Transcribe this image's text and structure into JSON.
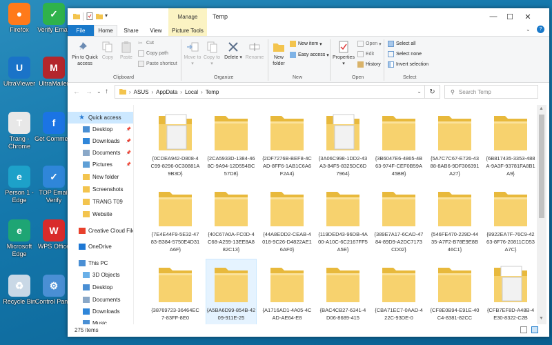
{
  "desktop": {
    "icons": [
      {
        "label": "Firefox",
        "color": "#ff7a1a",
        "glyph": "●"
      },
      {
        "label": "Verify Email",
        "color": "#2fb24b",
        "glyph": "✓"
      },
      {
        "label": "UltraViewer",
        "color": "#1a73c8",
        "glyph": "U"
      },
      {
        "label": "UltraMailer",
        "color": "#b3262c",
        "glyph": "M"
      },
      {
        "label": "Trang - Chrome",
        "color": "#e8e8e8",
        "glyph": "T"
      },
      {
        "label": "Get Comme...",
        "color": "#1b74e4",
        "glyph": "f"
      },
      {
        "label": "Person 1 - Edge",
        "color": "#1da1c9",
        "glyph": "e"
      },
      {
        "label": "TOP Email Verify",
        "color": "#2f86d9",
        "glyph": "✓"
      },
      {
        "label": "Microsoft Edge",
        "color": "#1ea574",
        "glyph": "e"
      },
      {
        "label": "WPS Office",
        "color": "#d92b2b",
        "glyph": "W"
      },
      {
        "label": "Recycle Bin",
        "color": "#c9d8e6",
        "glyph": "♻"
      },
      {
        "label": "Control Panel",
        "color": "#4a8fd4",
        "glyph": "⚙"
      }
    ]
  },
  "window": {
    "manage_tab": "Manage",
    "title": "Temp",
    "controls": {
      "minimize": "—",
      "maximize": "☐",
      "close": "✕"
    },
    "tabs": [
      "File",
      "Home",
      "Share",
      "View",
      "Picture Tools"
    ],
    "help": "?"
  },
  "ribbon": {
    "clipboard": {
      "pin": "Pin to Quick access",
      "copy": "Copy",
      "paste": "Paste",
      "cut": "Cut",
      "copy_path": "Copy path",
      "paste_shortcut": "Paste shortcut",
      "group": "Clipboard"
    },
    "organize": {
      "move_to": "Move to",
      "copy_to": "Copy to",
      "delete": "Delete",
      "rename": "Rename",
      "group": "Organize"
    },
    "new": {
      "new_folder": "New folder",
      "new_item": "New item",
      "easy_access": "Easy access",
      "group": "New"
    },
    "open": {
      "properties": "Properties",
      "open": "Open",
      "edit": "Edit",
      "history": "History",
      "group": "Open"
    },
    "select": {
      "select_all": "Select all",
      "select_none": "Select none",
      "invert_selection": "Invert selection",
      "group": "Select"
    }
  },
  "address": {
    "path": [
      "ASUS",
      "AppData",
      "Local",
      "Temp"
    ],
    "search_placeholder": "Search Temp"
  },
  "nav": {
    "items": [
      {
        "label": "Quick access",
        "icon": "star",
        "pinned": false,
        "indent": 0
      },
      {
        "label": "Desktop",
        "icon": "desktop",
        "pinned": true,
        "indent": 1
      },
      {
        "label": "Downloads",
        "icon": "download",
        "pinned": true,
        "indent": 1
      },
      {
        "label": "Documents",
        "icon": "document",
        "pinned": true,
        "indent": 1
      },
      {
        "label": "Pictures",
        "icon": "picture",
        "pinned": true,
        "indent": 1
      },
      {
        "label": "New folder",
        "icon": "folder",
        "pinned": false,
        "indent": 1
      },
      {
        "label": "Screenshots",
        "icon": "folder",
        "pinned": false,
        "indent": 1
      },
      {
        "label": "TRANG T09",
        "icon": "folder",
        "pinned": false,
        "indent": 1
      },
      {
        "label": "Website",
        "icon": "folder",
        "pinned": false,
        "indent": 1
      },
      {
        "label": "Creative Cloud File",
        "icon": "cloud-cc",
        "pinned": false,
        "indent": 0
      },
      {
        "label": "OneDrive",
        "icon": "onedrive",
        "pinned": false,
        "indent": 0
      },
      {
        "label": "This PC",
        "icon": "pc",
        "pinned": false,
        "indent": 0
      },
      {
        "label": "3D Objects",
        "icon": "cube",
        "pinned": false,
        "indent": 1
      },
      {
        "label": "Desktop",
        "icon": "desktop",
        "pinned": false,
        "indent": 1
      },
      {
        "label": "Documents",
        "icon": "document",
        "pinned": false,
        "indent": 1
      },
      {
        "label": "Downloads",
        "icon": "download",
        "pinned": false,
        "indent": 1
      },
      {
        "label": "Music",
        "icon": "music",
        "pinned": false,
        "indent": 1
      }
    ]
  },
  "files": [
    {
      "name": "{0CDEA942-D808-4C99-8296-0C30881A9B3D}",
      "type": "file"
    },
    {
      "name": "{2CA5933D-1384-468C-9A94-12D554BC57D8}",
      "type": "folder"
    },
    {
      "name": "{2DF7276B-BEF8-4CAD-8FF6-1AB1C6A6F2A4}",
      "type": "folder"
    },
    {
      "name": "{3A06C998-1DD2-43A3-84F5-8325DC6D7964}",
      "type": "file"
    },
    {
      "name": "{3B6047E6-4865-4B63-974F-CEF0B59A45BB}",
      "type": "folder"
    },
    {
      "name": "{5A7C7C67-E726-4388-8AB6-9DF306391A27}",
      "type": "folder"
    },
    {
      "name": "{6B817435-3353-488A-9A3F-93781FA8B1A9}",
      "type": "folder"
    },
    {
      "name": "{7E4E44F9-5E32-4783-B384-5750E4D31A6F}",
      "type": "folder"
    },
    {
      "name": "{40C67A0A-FC0D-4C68-A259-13EE8A882C13}",
      "type": "folder"
    },
    {
      "name": "{44A8EDD2-CEAB-4018-9C26-D4822AE16AF0}",
      "type": "folder"
    },
    {
      "name": "{119DED43-96DB-4A00-A10C-6C2167FF5A5E}",
      "type": "folder"
    },
    {
      "name": "{389E7A17-6CAD-4784-89D9-A2DC7173CD02}",
      "type": "folder"
    },
    {
      "name": "{546FE470-229D-4435-A7F2-B78E9E8B46C1}",
      "type": "folder"
    },
    {
      "name": "{8922EA7F-76C9-4263-8F76-20811CD53A7C}",
      "type": "folder"
    },
    {
      "name": "{38769723-36464EC7-83FF-8E0",
      "type": "folder"
    },
    {
      "name": "{A5BA6D99-854B-4209-911E-25",
      "type": "folder"
    },
    {
      "name": "{A1716AD1-4A05-4CAD-AE64-E8",
      "type": "folder"
    },
    {
      "name": "{BAC4CB27-6341-4D06-8689-415",
      "type": "folder"
    },
    {
      "name": "{CBA71EC7-0AAD-422C-93DE-0",
      "type": "folder"
    },
    {
      "name": "{CF8E0B94-E91E-40C4-8381-82CC",
      "type": "folder"
    },
    {
      "name": "{CFB7EF8D-A48B-4E30-8322-C2B",
      "type": "file"
    }
  ],
  "status": {
    "count": "275 items"
  }
}
